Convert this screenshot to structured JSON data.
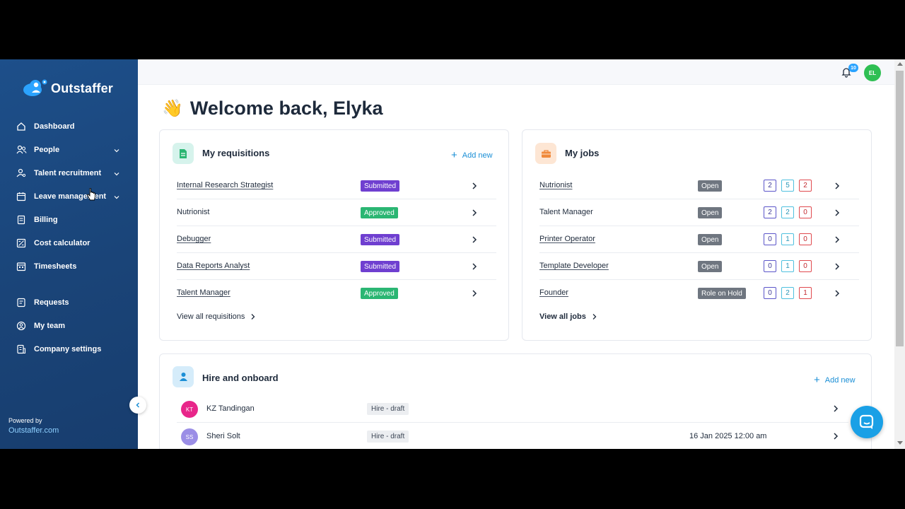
{
  "brand": {
    "name": "Outstaffer",
    "logo_icon": "cloud-person-logo"
  },
  "sidebar": {
    "items": [
      {
        "label": "Dashboard",
        "icon": "home-icon",
        "expandable": false
      },
      {
        "label": "People",
        "icon": "people-icon",
        "expandable": true
      },
      {
        "label": "Talent recruitment",
        "icon": "user-search-icon",
        "expandable": true
      },
      {
        "label": "Leave management",
        "icon": "calendar-icon",
        "expandable": true
      },
      {
        "label": "Billing",
        "icon": "receipt-icon",
        "expandable": false
      },
      {
        "label": "Cost calculator",
        "icon": "calculator-icon",
        "expandable": false
      },
      {
        "label": "Timesheets",
        "icon": "timesheet-icon",
        "expandable": false
      }
    ],
    "secondary_items": [
      {
        "label": "Requests",
        "icon": "request-icon"
      },
      {
        "label": "My team",
        "icon": "team-icon"
      },
      {
        "label": "Company settings",
        "icon": "building-icon"
      }
    ],
    "powered_by": "Powered by",
    "powered_link": "Outstaffer.com"
  },
  "topbar": {
    "notification_count": "10",
    "user_initials": "EL"
  },
  "welcome": {
    "emoji": "👋",
    "title": "Welcome back, Elyka"
  },
  "requisitions": {
    "title": "My requisitions",
    "add_new": "Add new",
    "rows": [
      {
        "name": "Internal Research Strategist",
        "status": "Submitted"
      },
      {
        "name": "Nutrionist",
        "status": "Approved"
      },
      {
        "name": "Debugger",
        "status": "Submitted"
      },
      {
        "name": "Data Reports Analyst",
        "status": "Submitted"
      },
      {
        "name": "Talent Manager",
        "status": "Approved"
      }
    ],
    "view_all": "View all requisitions"
  },
  "jobs": {
    "title": "My jobs",
    "rows": [
      {
        "name": "Nutrionist",
        "status": "Open",
        "counts": [
          "2",
          "5",
          "2"
        ]
      },
      {
        "name": "Talent Manager",
        "status": "Open",
        "counts": [
          "2",
          "2",
          "0"
        ]
      },
      {
        "name": "Printer Operator",
        "status": "Open",
        "counts": [
          "0",
          "1",
          "0"
        ]
      },
      {
        "name": "Template Developer",
        "status": "Open",
        "counts": [
          "0",
          "1",
          "0"
        ]
      },
      {
        "name": "Founder",
        "status": "Role on Hold",
        "counts": [
          "0",
          "2",
          "1"
        ]
      }
    ],
    "view_all": "View all jobs"
  },
  "hire": {
    "title": "Hire and onboard",
    "add_new": "Add new",
    "rows": [
      {
        "initials": "KT",
        "name": "KZ Tandingan",
        "status": "Hire - draft",
        "date": "",
        "avatar_color": "#e8268a"
      },
      {
        "initials": "SS",
        "name": "Sheri Solt",
        "status": "Hire - draft",
        "date": "16 Jan 2025 12:00 am",
        "avatar_color": "#9b8ee6"
      }
    ]
  },
  "colors": {
    "sidebar": "#1a4478",
    "accent": "#1b8fd6",
    "submitted": "#6f3fd0",
    "approved": "#2bb673",
    "open": "#6f7680"
  }
}
